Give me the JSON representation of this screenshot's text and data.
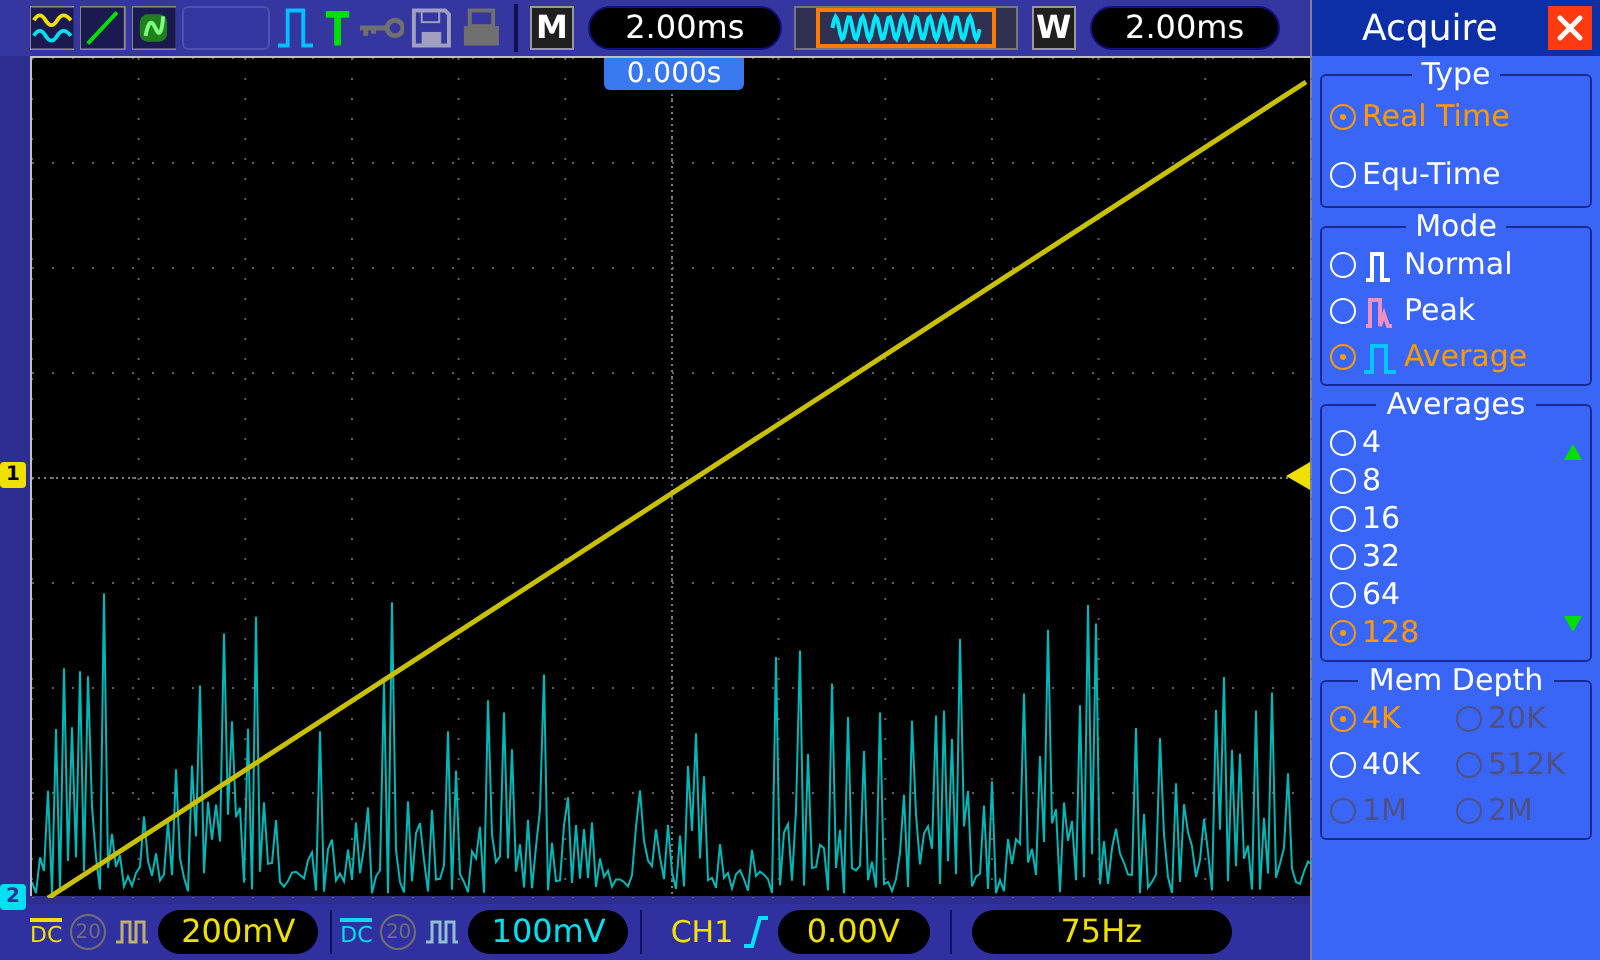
{
  "toolbar": {
    "memory_label": "M",
    "timebase": "2.00ms",
    "window_label": "W",
    "window_time": "2.00ms"
  },
  "screen": {
    "trigger_position": "0.000s",
    "channel_markers": [
      {
        "label": "1",
        "color": "#f0e000"
      },
      {
        "label": "2",
        "color": "#00e0f0"
      }
    ]
  },
  "menu": {
    "title": "Acquire",
    "sections": [
      {
        "title": "Type",
        "kind": "list",
        "options": [
          {
            "label": "Real Time",
            "selected": true,
            "disabled": false
          },
          {
            "label": "Equ-Time",
            "selected": false,
            "disabled": false
          }
        ]
      },
      {
        "title": "Mode",
        "kind": "icons",
        "options": [
          {
            "label": "Normal",
            "selected": false,
            "disabled": false,
            "kind": "normal"
          },
          {
            "label": "Peak",
            "selected": false,
            "disabled": false,
            "kind": "peak"
          },
          {
            "label": "Average",
            "selected": true,
            "disabled": false,
            "kind": "average"
          }
        ]
      },
      {
        "title": "Averages",
        "kind": "scroll",
        "options": [
          {
            "label": "4",
            "selected": false,
            "disabled": false
          },
          {
            "label": "8",
            "selected": false,
            "disabled": false
          },
          {
            "label": "16",
            "selected": false,
            "disabled": false
          },
          {
            "label": "32",
            "selected": false,
            "disabled": false
          },
          {
            "label": "64",
            "selected": false,
            "disabled": false
          },
          {
            "label": "128",
            "selected": true,
            "disabled": false
          }
        ]
      },
      {
        "title": "Mem Depth",
        "kind": "grid",
        "options": [
          {
            "label": "4K",
            "selected": true,
            "disabled": false
          },
          {
            "label": "20K",
            "selected": false,
            "disabled": true
          },
          {
            "label": "40K",
            "selected": false,
            "disabled": false
          },
          {
            "label": "512K",
            "selected": false,
            "disabled": true
          },
          {
            "label": "1M",
            "selected": false,
            "disabled": true
          },
          {
            "label": "2M",
            "selected": false,
            "disabled": true
          }
        ]
      }
    ]
  },
  "status_bar": {
    "channels": [
      {
        "coupling": "DC",
        "bandwidth_limit": "20",
        "scale": "200mV",
        "color": "#f0e000"
      },
      {
        "coupling": "DC",
        "bandwidth_limit": "20",
        "scale": "100mV",
        "color": "#00e0f0"
      }
    ],
    "trigger": {
      "source": "CH1",
      "level": "0.00V"
    },
    "frequency": "75Hz"
  }
}
